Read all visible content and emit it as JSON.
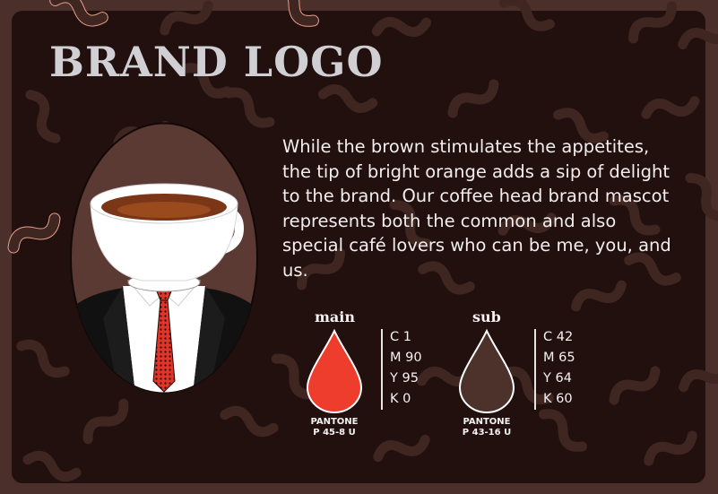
{
  "colors": {
    "frame": "#4a2f2a",
    "panel": "#22100f",
    "squiggle": "#3f2621",
    "squiggle_edge": "#e8a08c",
    "title": "#d0cfd4",
    "main_swatch": "#ee3c2d",
    "sub_swatch": "#4d322c"
  },
  "header": {
    "title": "BRAND LOGO"
  },
  "description": "While the brown stimulates the appetites, the tip of bright orange adds a sip of delight to the brand. Our coffee head brand mascot represents both the common and also special café lovers who can be me, you, and us.",
  "swatches": {
    "main": {
      "label": "main",
      "pantone_line1": "PANTONE",
      "pantone_line2": "P 45-8 U",
      "cmyk": [
        "C 1",
        "M 90",
        "Y 95",
        "K 0"
      ]
    },
    "sub": {
      "label": "sub",
      "pantone_line1": "PANTONE",
      "pantone_line2": "P 43-16 U",
      "cmyk": [
        "C 42",
        "M 65",
        "Y 64",
        "K 60"
      ]
    }
  }
}
